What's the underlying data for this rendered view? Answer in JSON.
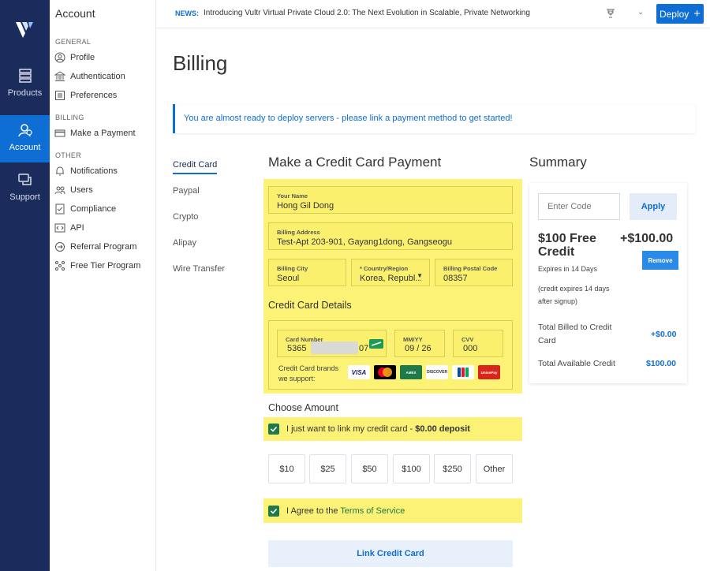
{
  "rail": {
    "items": [
      {
        "label": "Products"
      },
      {
        "label": "Account"
      },
      {
        "label": "Support"
      }
    ]
  },
  "submenu": {
    "title": "Account",
    "general_heading": "GENERAL",
    "general": [
      "Profile",
      "Authentication",
      "Preferences"
    ],
    "billing_heading": "BILLING",
    "billing": [
      "Make a Payment"
    ],
    "other_heading": "OTHER",
    "other": [
      "Notifications",
      "Users",
      "Compliance",
      "API",
      "Referral Program",
      "Free Tier Program"
    ]
  },
  "topbar": {
    "news_tag": "NEWS:",
    "news_text": "Introducing Vultr Virtual Private Cloud 2.0: The Next Evolution in Scalable, Private Networking",
    "deploy_label": "Deploy",
    "deploy_icon": "+"
  },
  "page": {
    "title": "Billing",
    "alert": "You are almost ready to deploy servers - please link a payment method to get started!"
  },
  "tabs": [
    "Credit Card",
    "Paypal",
    "Crypto",
    "Alipay",
    "Wire Transfer"
  ],
  "payment": {
    "title": "Make a Credit Card Payment",
    "name_label": "Your Name",
    "name_value": "Hong Gil Dong",
    "address_label": "Billing Address",
    "address_value": "Test-Apt 203-901, Gayang1dong, Gangseogu",
    "city_label": "Billing City",
    "city_value": "Seoul",
    "country_label": "* Country/Region",
    "country_value": "Korea, Republ...",
    "postal_label": "Billing Postal Code",
    "postal_value": "08357",
    "cc_title": "Credit Card Details",
    "card_number_label": "Card Number",
    "card_number_start": "5365",
    "card_number_end": "07",
    "expiry_label": "MM/YY",
    "expiry_value": "09 / 26",
    "cvv_label": "CVV",
    "cvv_value": "000",
    "brands_label_1": "Credit Card brands",
    "brands_label_2": "we support:",
    "brands": [
      "VISA",
      "MC",
      "AMEX",
      "DISCOVER",
      "JCB",
      "UnionPay"
    ]
  },
  "amount": {
    "title": "Choose Amount",
    "link_only_text": "I just want to link my credit card - ",
    "link_only_bold": "$0.00 deposit",
    "options": [
      "$10",
      "$25",
      "$50",
      "$100",
      "$250",
      "Other"
    ],
    "terms_prefix": "I Agree to the ",
    "terms_link": "Terms of Service",
    "submit_label": "Link Credit Card"
  },
  "summary": {
    "title": "Summary",
    "code_placeholder": "Enter Code",
    "apply_label": "Apply",
    "credit_title": "$100 Free Credit",
    "credit_amount": "+$100.00",
    "remove_label": "Remove",
    "expires": "Expires in 14 Days",
    "expires_note": "(credit expires 14 days after signup)",
    "billed_label": "Total Billed to Credit Card",
    "billed_value": "+$0.00",
    "available_label": "Total Available Credit",
    "available_value": "$100.00"
  },
  "colors": {
    "rail_bg": "#1b2b5b",
    "accent": "#0e6ed3",
    "highlight": "#fbf276",
    "checkbox": "#1f7a4a"
  }
}
